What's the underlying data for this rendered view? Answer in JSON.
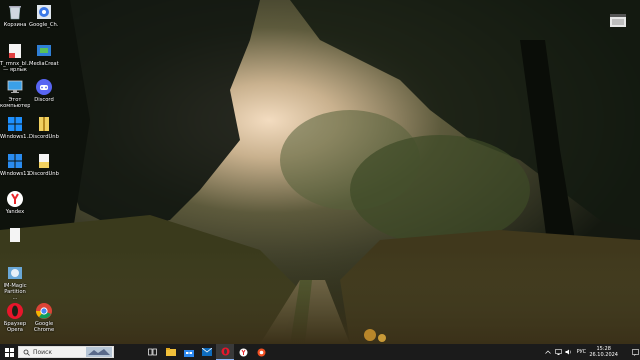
{
  "desktop": {
    "icons": [
      {
        "label": "Корзина"
      },
      {
        "label": "Google_Ch..."
      },
      {
        "label": "Т_rmnx_bl...\n— ярлык"
      },
      {
        "label": "MediaCreat..."
      },
      {
        "label": "Этот\nкомпьютер"
      },
      {
        "label": "Discord"
      },
      {
        "label": "Windows1..."
      },
      {
        "label": "DiscordUnb..."
      },
      {
        "label": "Windows11..."
      },
      {
        "label": "DiscordUnb..."
      },
      {
        "label": "Yandex"
      },
      {
        "label": ""
      },
      {
        "label": "IM-Magic\nPartition\n..."
      },
      {
        "label": "Браузер\nOpera"
      },
      {
        "label": "Google\nChrome"
      }
    ]
  },
  "taskbar": {
    "search_placeholder": "Поиск",
    "language": "РУС",
    "time": "15:28",
    "date": "26.10.2024"
  },
  "colors": {
    "taskbar_bg": "#1b1b1b",
    "search_bg": "#f2f2f2"
  }
}
